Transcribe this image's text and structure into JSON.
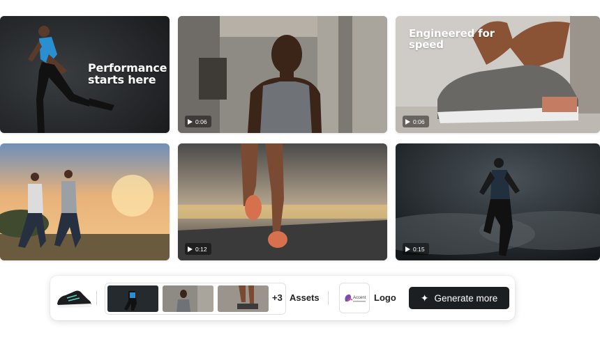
{
  "tiles": [
    {
      "id": "performance",
      "overlay": "Performance\nstarts here",
      "duration": ""
    },
    {
      "id": "tank-top-runner",
      "overlay": "",
      "duration": "0:06"
    },
    {
      "id": "shoe-lacing",
      "overlay": "Engineered for\nspeed",
      "duration": "0:06"
    },
    {
      "id": "sunset-runners",
      "overlay": "",
      "duration": ""
    },
    {
      "id": "legs-on-road",
      "overlay": "",
      "duration": "0:12"
    },
    {
      "id": "smoke-runner",
      "overlay": "",
      "duration": "0:15"
    }
  ],
  "bar": {
    "extra_count": "+3",
    "assets_label": "Assets",
    "logo_label": "Logo",
    "logo_text": "Accent",
    "generate_label": "Generate more"
  },
  "icons": {
    "play": "play-icon",
    "sparkle": "sparkle-icon",
    "shoe": "shoe-icon"
  }
}
